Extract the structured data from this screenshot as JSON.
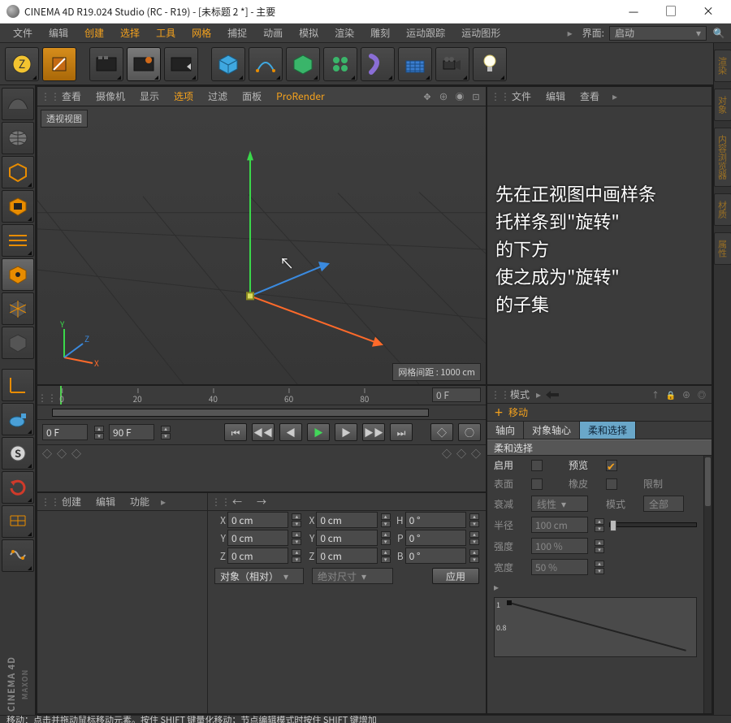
{
  "window": {
    "title": "CINEMA 4D R19.024 Studio (RC - R19) - [未标题 2 *] - 主要",
    "min": "—",
    "max": "□",
    "close": "×"
  },
  "menu": {
    "items": [
      "文件",
      "编辑",
      "创建",
      "选择",
      "工具",
      "网格",
      "捕捉",
      "动画",
      "模拟",
      "渲染",
      "雕刻",
      "运动跟踪",
      "运动图形"
    ],
    "accent_idx": [
      2,
      3,
      4,
      5
    ],
    "ui_label": "界面:",
    "ui_value": "启动"
  },
  "toolbar_icons": [
    "undo-redo-icon",
    "make-editable-icon",
    "render-view-icon",
    "render-region-icon",
    "render-settings-icon",
    "cube-primitive-icon",
    "spline-tool-icon",
    "subdiv-surface-icon",
    "array-icon",
    "bend-icon",
    "floor-icon",
    "camera-icon",
    "light-icon"
  ],
  "left_tools": [
    "live-select-icon",
    "model-mode-icon",
    "texture-mode-icon",
    "workplane-icon",
    "point-mode-icon",
    "edge-mode-icon",
    "poly-mode-icon",
    "axis-icon",
    "move-tool-icon",
    "scale-tool-icon",
    "rotate-tool-icon",
    "recent-tool-icon",
    "snap-icon",
    "quantize-icon"
  ],
  "right_tabs": [
    "渲染",
    "对象",
    "内容浏览器",
    "材质",
    "属性"
  ],
  "brand": {
    "line1": "CINEMA 4D",
    "line2": "MAXON"
  },
  "viewport": {
    "top_menus": [
      "查看",
      "摄像机",
      "显示",
      "选项",
      "过滤",
      "面板",
      "ProRender"
    ],
    "accent_idx": [
      3,
      6
    ],
    "label": "透视视图",
    "grid_label": "网格间距 :",
    "grid_value": "1000 cm",
    "axis_labels": {
      "x": "X",
      "y": "Y",
      "z": "Z"
    }
  },
  "overlay_lines": [
    "先在正视图中画样条",
    "托样条到\"旋转\"",
    "的下方",
    "使之成为\"旋转\"",
    "的子集"
  ],
  "timeline": {
    "ticks": [
      "0",
      "20",
      "40",
      "60",
      "80"
    ],
    "current": "0 F",
    "start": "0 F",
    "end": "90 F"
  },
  "coords": {
    "left_menus": [
      "创建",
      "编辑",
      "功能"
    ],
    "right_menus": [
      "←",
      "→"
    ],
    "rows": [
      {
        "axis": "X",
        "pos": "0 cm",
        "size": "0 cm",
        "rot_label": "H",
        "rot": "0 °"
      },
      {
        "axis": "Y",
        "pos": "0 cm",
        "size": "0 cm",
        "rot_label": "P",
        "rot": "0 °"
      },
      {
        "axis": "Z",
        "pos": "0 cm",
        "size": "0 cm",
        "rot_label": "B",
        "rot": "0 °"
      }
    ],
    "mode1": "对象（相对）",
    "mode2": "绝对尺寸",
    "apply": "应用"
  },
  "objmgr": {
    "menus": [
      "文件",
      "编辑",
      "查看"
    ]
  },
  "attr": {
    "mode_label": "模式",
    "tool_title": "移动",
    "tabs": [
      "轴向",
      "对象轴心",
      "柔和选择"
    ],
    "active_tab": 2,
    "section": "柔和选择",
    "fields": {
      "enable_label": "启用",
      "preview_label": "预览",
      "surface_label": "表面",
      "rubber_label": "橡皮",
      "limit_label": "限制",
      "falloff_label": "衰减",
      "falloff_value": "线性",
      "mode_label": "模式",
      "mode_value": "全部",
      "radius_label": "半径",
      "radius_value": "100 cm",
      "strength_label": "强度",
      "strength_value": "100 %",
      "width_label": "宽度",
      "width_value": "50 %"
    },
    "curve_yticks": [
      "1",
      "0.8"
    ]
  },
  "status_text": "移动：点击并拖动鼠标移动元素。按住 SHIFT 键量化移动；节点编辑模式时按住 SHIFT 键增加"
}
